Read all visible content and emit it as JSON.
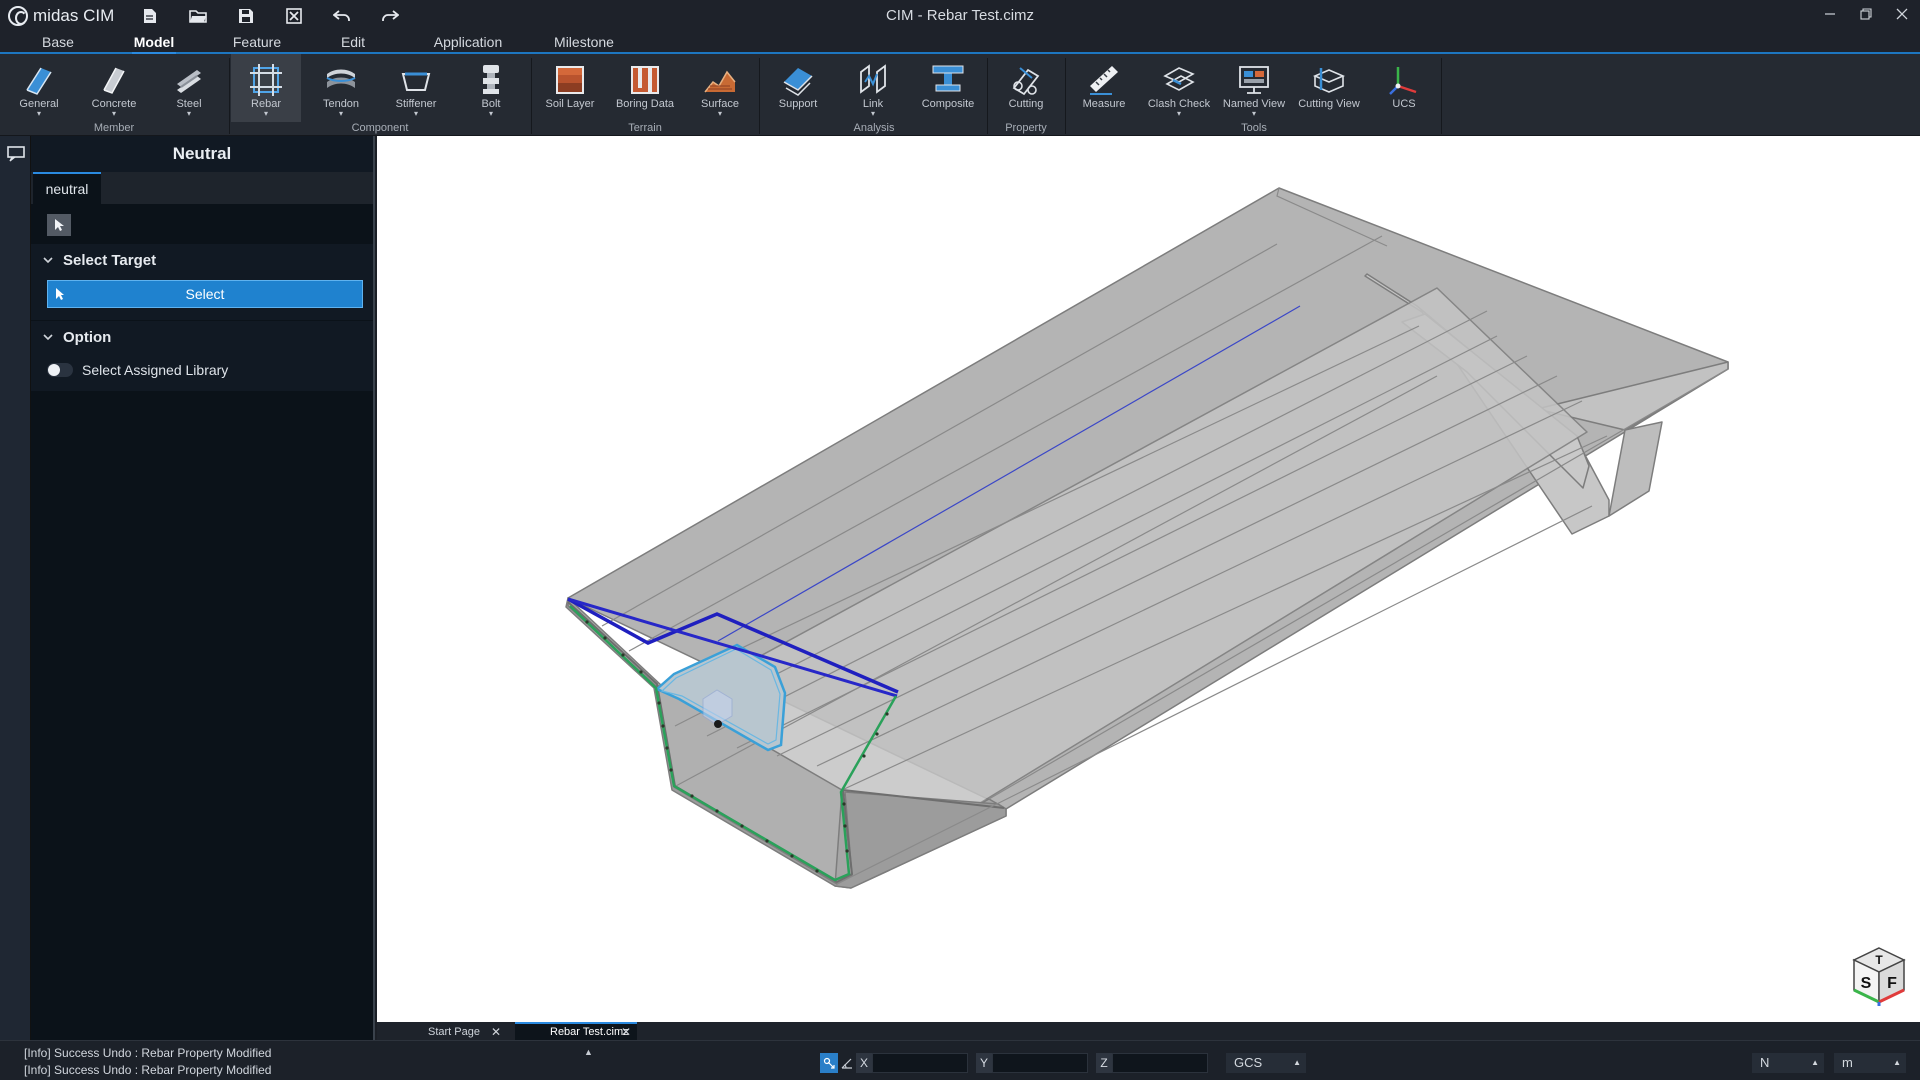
{
  "app": {
    "brand": "midas CIM",
    "window_title": "CIM - Rebar Test.cimz",
    "quick_access": [
      "new-file-icon",
      "open-folder-icon",
      "save-icon",
      "close-file-icon",
      "undo-icon",
      "redo-icon"
    ],
    "window_controls": [
      "minimize-icon",
      "restore-icon",
      "close-icon"
    ]
  },
  "menu": {
    "tabs": [
      "Base",
      "Model",
      "Feature",
      "Edit",
      "Application",
      "Milestone"
    ],
    "active": "Model"
  },
  "ribbon": {
    "groups": [
      {
        "name": "Member",
        "buttons": [
          "General",
          "Concrete",
          "Steel"
        ]
      },
      {
        "name": "Component",
        "buttons": [
          "Rebar",
          "Tendon",
          "Stiffener",
          "Bolt"
        ]
      },
      {
        "name": "Terrain",
        "buttons": [
          "Soil Layer",
          "Boring Data",
          "Surface"
        ]
      },
      {
        "name": "Analysis",
        "buttons": [
          "Support",
          "Link",
          "Composite"
        ]
      },
      {
        "name": "Property",
        "buttons": [
          "Cutting"
        ]
      },
      {
        "name": "Tools",
        "buttons": [
          "Measure",
          "Clash Check",
          "Named View",
          "Cutting View",
          "UCS"
        ]
      }
    ],
    "hovered": "Rebar"
  },
  "panel": {
    "title": "Neutral",
    "tab": "neutral",
    "select_target": {
      "header": "Select Target",
      "button": "Select"
    },
    "option": {
      "header": "Option",
      "toggle_label": "Select Assigned Library",
      "toggle_on": false
    }
  },
  "viewport": {
    "view_cube": {
      "top": "T",
      "left": "S",
      "right": "F"
    }
  },
  "doc_tabs": [
    {
      "label": "Start Page",
      "active": false
    },
    {
      "label": "Rebar Test.cimz",
      "active": true
    }
  ],
  "status": {
    "log": [
      "[Info] Success Undo : Rebar Property Modified",
      "[Info] Success Undo : Rebar Property Modified"
    ],
    "x_label": "X",
    "y_label": "Y",
    "z_label": "Z",
    "coord_system": "GCS",
    "force_unit": "N",
    "length_unit": "m"
  },
  "colors": {
    "accent": "#2a8ae0",
    "select_button": "#1f82cf",
    "top_rebar": "#2727c8",
    "shear_rebar": "#2aa15a",
    "inner_rebar": "#3aa0d8"
  }
}
